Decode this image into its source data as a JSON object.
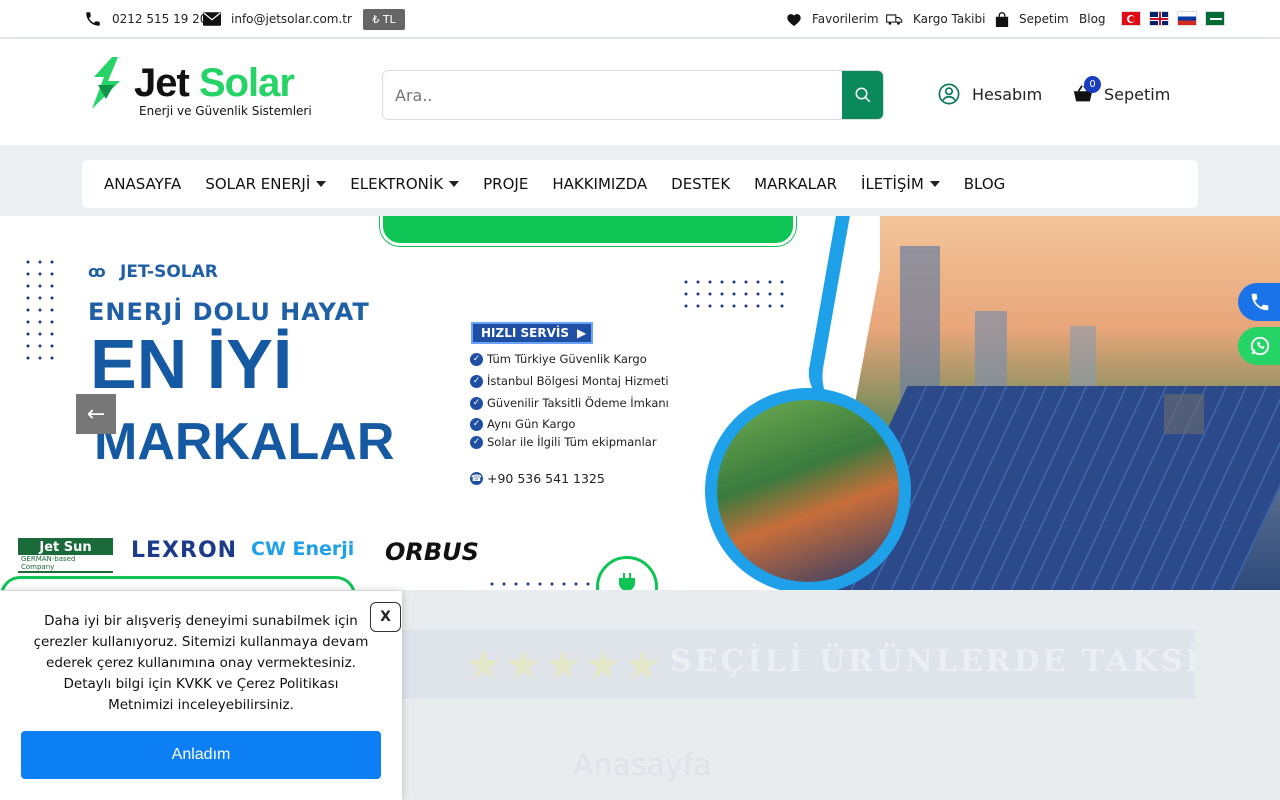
{
  "topbar": {
    "phone": "0212 515 19 20",
    "email": "info@jetsolar.com.tr",
    "currency": "₺ TL",
    "links": [
      "Favorilerim",
      "Kargo Takibi",
      "Sepetim",
      "Blog"
    ]
  },
  "header": {
    "logo_title_a": "Jet",
    "logo_title_b": "Solar",
    "logo_subtitle": "Enerji ve Güvenlik Sistemleri",
    "search_placeholder": "Ara..",
    "account_label": "Hesabım",
    "cart_label": "Sepetim",
    "cart_count": "0"
  },
  "nav": {
    "items": [
      "ANASAYFA",
      "SOLAR ENERJİ",
      "ELEKTRONİK",
      "PROJE",
      "HAKKIMIZDA",
      "DESTEK",
      "MARKALAR",
      "İLETİŞİM",
      "BLOG"
    ]
  },
  "hero": {
    "brand": "JET-SOLAR",
    "headline1": "ENERJİ DOLU HAYAT",
    "headline2": "EN İYİ",
    "headline3": "MARKALAR",
    "service_badge": "HIZLI SERVİS",
    "services": [
      "Tüm Türkiye Güvenlik Kargo",
      "İstanbul Bölgesi Montaj Hizmeti",
      "Güvenilir Taksitli Ödeme İmkanı",
      "Aynı Gün Kargo",
      "Solar ile İlgili Tüm ekipmanlar"
    ],
    "phone": "+90 536 541 1325",
    "brands": {
      "b1": "Jet Sun",
      "b1_sub": "GERMAN-based Company",
      "b2": "LEXRON",
      "b3": "CW Enerji",
      "b4": "ORBUS"
    }
  },
  "promo_text": "SEÇİLİ ÜRÜNLERDE TAKSİT",
  "breadcrumb_title": "Anasayfa",
  "cookie": {
    "text": "Daha iyi bir alışveriş deneyimi sunabilmek için çerezler kullanıyoruz. Sitemizi kullanmaya devam ederek çerez kullanımına onay vermektesiniz. Detaylı bilgi için KVKK ve Çerez Politikası Metnimizi inceleyebilirsiniz.",
    "close": "X",
    "accept": "Anladım"
  },
  "colors": {
    "brand_green": "#25d366",
    "search_btn": "#0a8a5c",
    "accept_blue": "#0d7ff5",
    "hero_blue": "#1559a3"
  }
}
